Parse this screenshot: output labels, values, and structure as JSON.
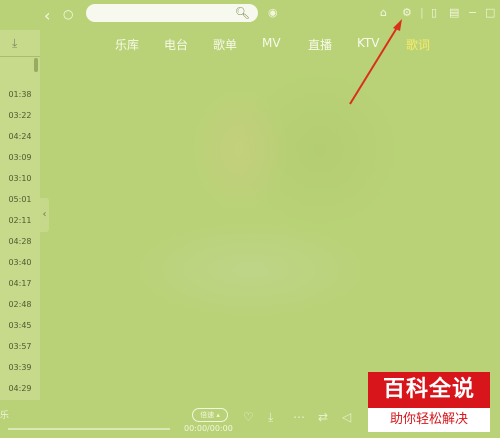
{
  "titlebar": {
    "back_icon": "chevron-left-icon",
    "refresh_icon": "circle-icon",
    "search_icon": "search-icon",
    "right_icons": [
      "tshirt-icon",
      "gear-icon",
      "minimize-icon",
      "mini-player-icon",
      "maximize-icon"
    ]
  },
  "nav_tabs": [
    {
      "label": "乐库",
      "active": false
    },
    {
      "label": "电台",
      "active": false
    },
    {
      "label": "歌单",
      "active": false
    },
    {
      "label": "MV",
      "active": false
    },
    {
      "label": "直播",
      "active": false
    },
    {
      "label": "KTV",
      "active": false
    },
    {
      "label": "歌词",
      "active": true
    }
  ],
  "sidebar": {
    "durations": [
      "01:38",
      "03:22",
      "04:24",
      "03:09",
      "03:10",
      "05:01",
      "02:11",
      "04:28",
      "03:40",
      "04:17",
      "02:48",
      "03:45",
      "03:57",
      "03:39",
      "04:29"
    ]
  },
  "player": {
    "speed_label": "倍速",
    "time": "00:00/00:00",
    "ticker_text": "乐"
  },
  "watermark": {
    "line1": "百科全说",
    "line2": "助你轻松解决"
  },
  "colors": {
    "background": "#b9d277",
    "active_tab": "#f6ec6a",
    "annotation_arrow": "#d9301c",
    "watermark_red": "#d7151a"
  }
}
